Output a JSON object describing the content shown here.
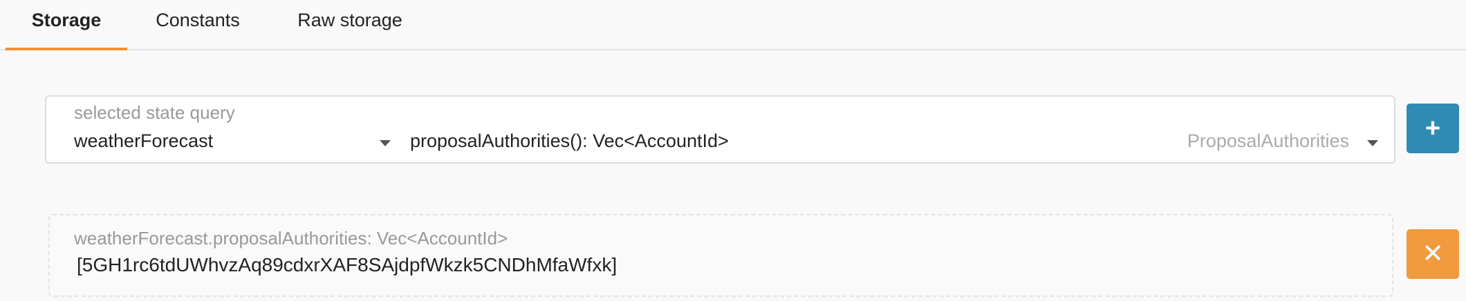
{
  "tabs": [
    {
      "label": "Storage",
      "active": true
    },
    {
      "label": "Constants",
      "active": false
    },
    {
      "label": "Raw storage",
      "active": false
    }
  ],
  "query": {
    "label": "selected state query",
    "module": "weatherForecast",
    "method": "proposalAuthorities(): Vec<AccountId>",
    "method_type": "ProposalAuthorities"
  },
  "result": {
    "label": "weatherForecast.proposalAuthorities: Vec<AccountId>",
    "value": "[5GH1rc6tdUWhvzAq89cdxrXAF8SAjdpfWkzk5CNDhMfaWfxk]"
  },
  "buttons": {
    "add_icon": "plus-icon",
    "remove_icon": "close-icon",
    "add_glyph": "+",
    "remove_glyph": "✕"
  },
  "colors": {
    "accent_tab": "#f19135",
    "add_button": "#2f8bb2",
    "remove_button": "#f19a3e"
  }
}
